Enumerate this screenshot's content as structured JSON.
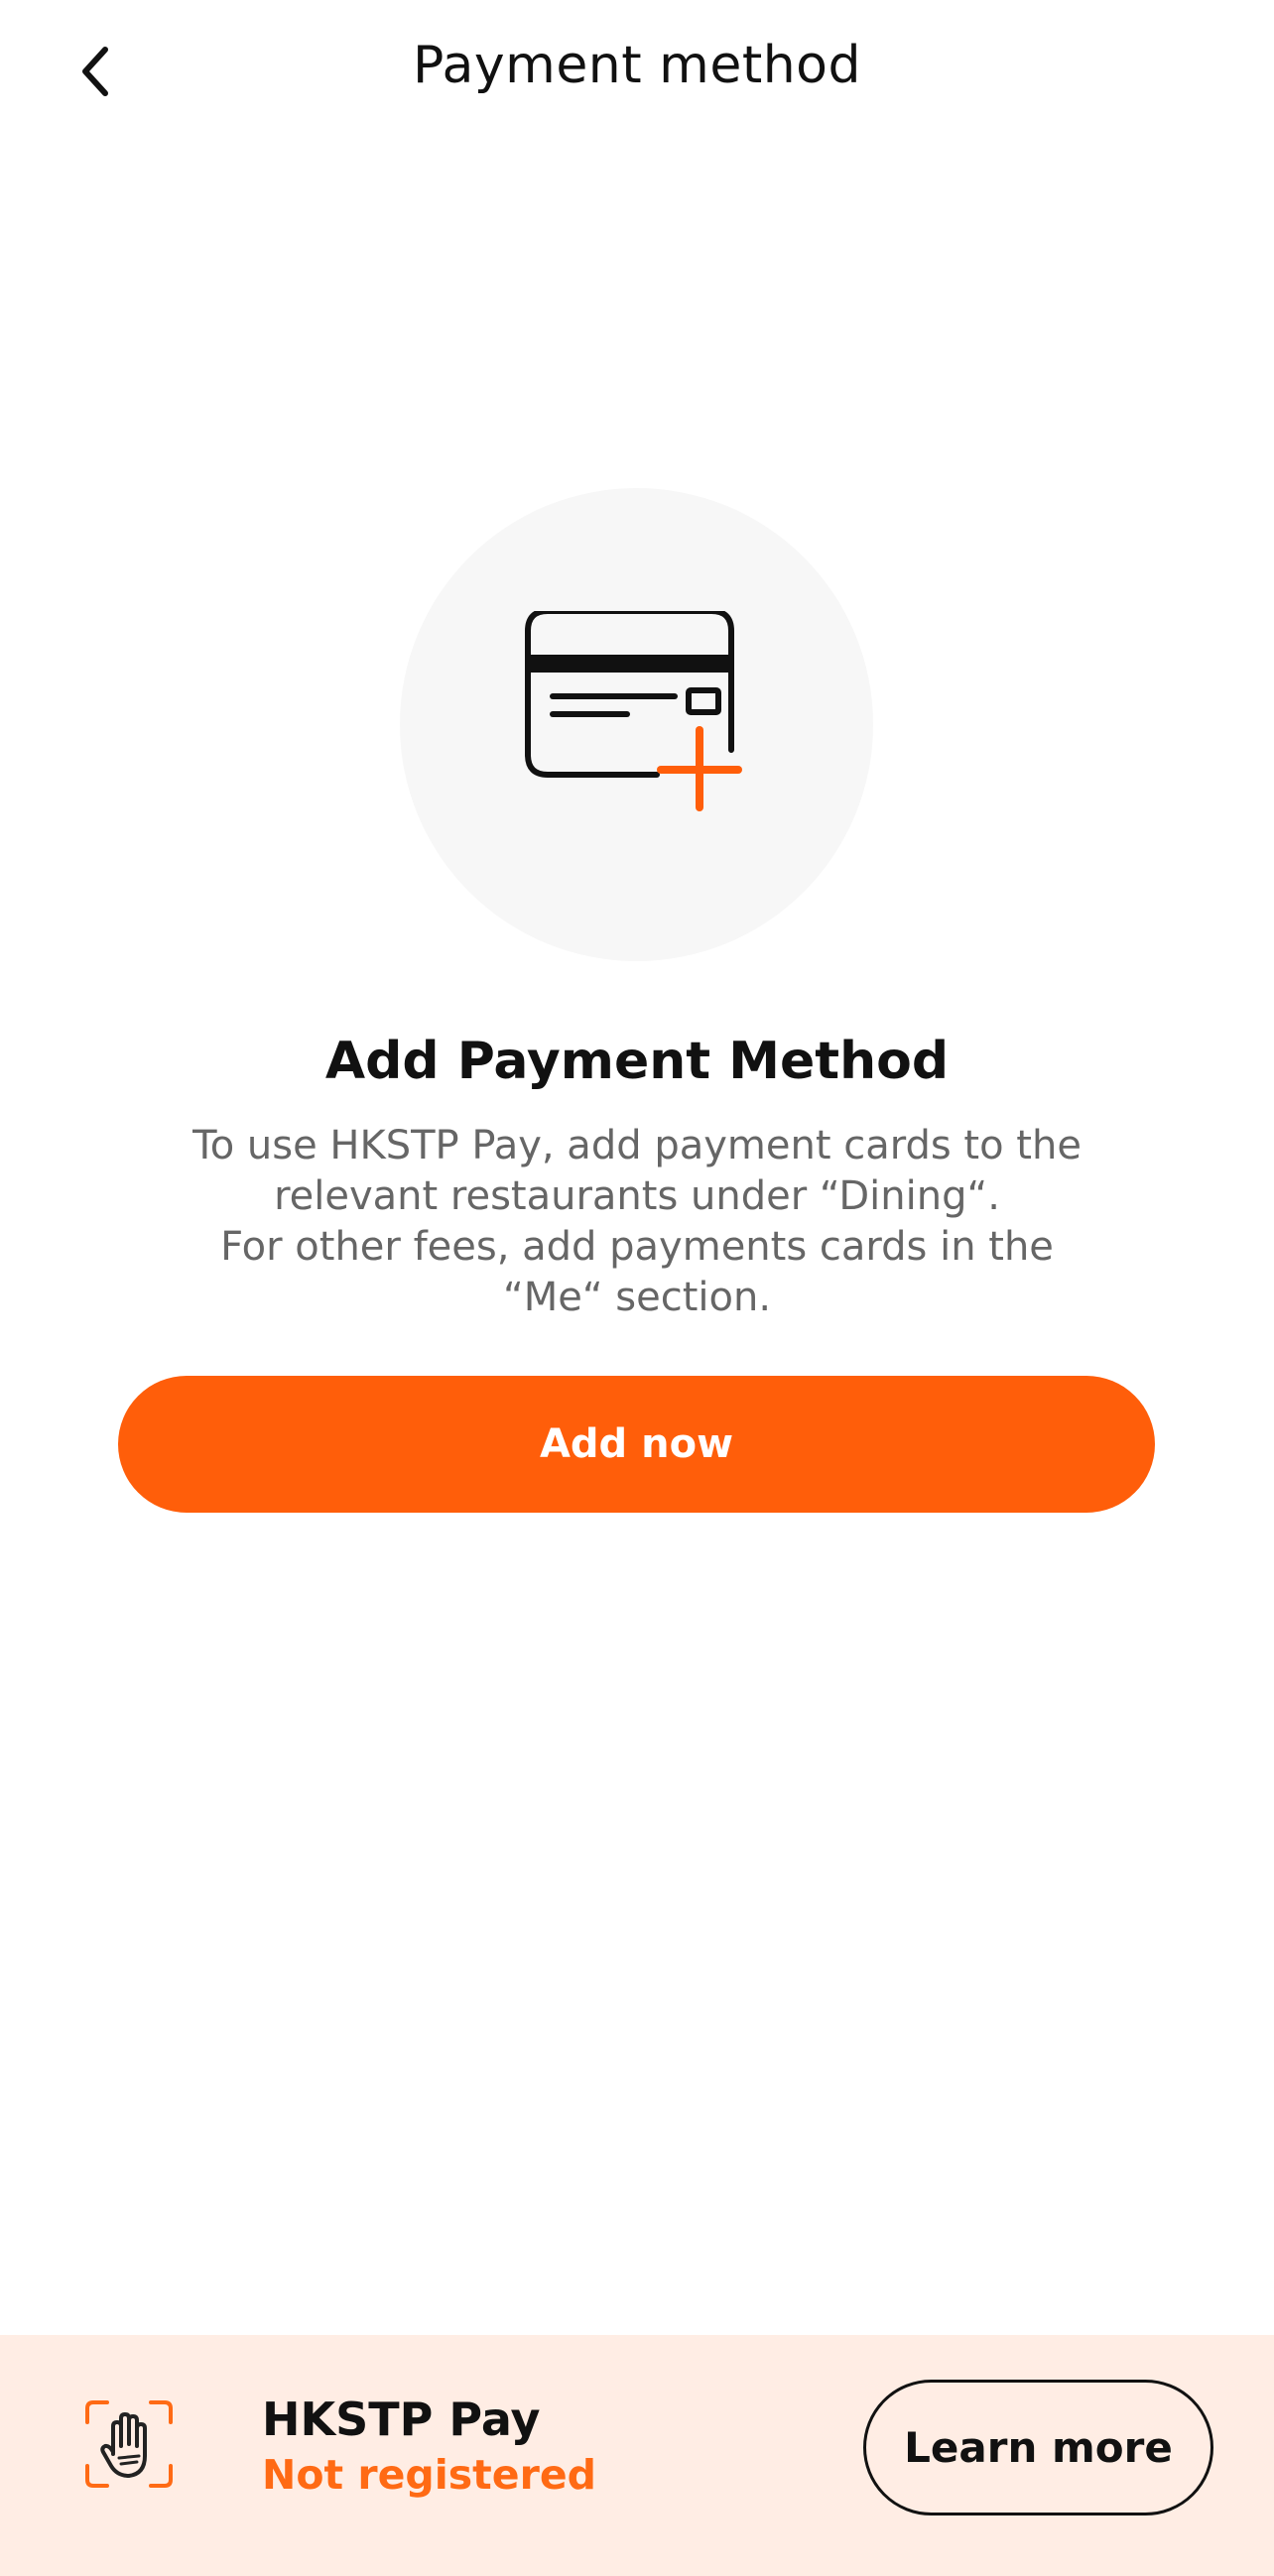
{
  "header": {
    "title": "Payment method",
    "back_icon": "chevron-left-icon"
  },
  "empty_state": {
    "illustration_icon": "credit-card-add-icon",
    "title": "Add Payment Method",
    "description_lines": [
      "To use HKSTP Pay, add payment cards to the",
      "relevant restaurants under “Dining“.",
      "For other fees, add payments cards in the",
      "“Me“ section."
    ],
    "add_button_label": "Add now"
  },
  "banner": {
    "icon": "palm-scan-icon",
    "title": "HKSTP Pay",
    "status": "Not registered",
    "learn_more_label": "Learn more"
  },
  "colors": {
    "accent": "#ff5e0a",
    "status": "#ff6a14",
    "banner_bg": "#ffede4",
    "illustration_bg": "#f7f7f7"
  }
}
